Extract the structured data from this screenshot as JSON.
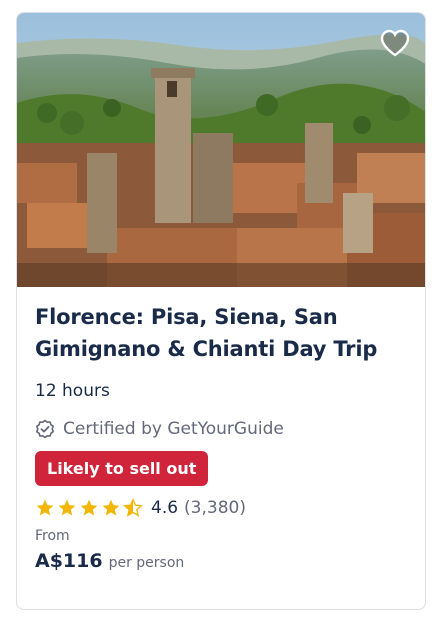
{
  "card": {
    "title": "Florence: Pisa, Siena, San Gimignano & Chianti Day Trip",
    "duration": "12 hours",
    "certified": "Certified by GetYourGuide",
    "badge": "Likely to sell out",
    "rating": {
      "value": "4.6",
      "count": "(3,380)",
      "stars": 4.6
    },
    "from_label": "From",
    "price": "A$116",
    "per_person": "per person",
    "wishlist_icon": "heart-icon"
  },
  "colors": {
    "title": "#1a2b49",
    "badge": "#d0243a",
    "star": "#f2b705",
    "muted": "#63687a"
  }
}
